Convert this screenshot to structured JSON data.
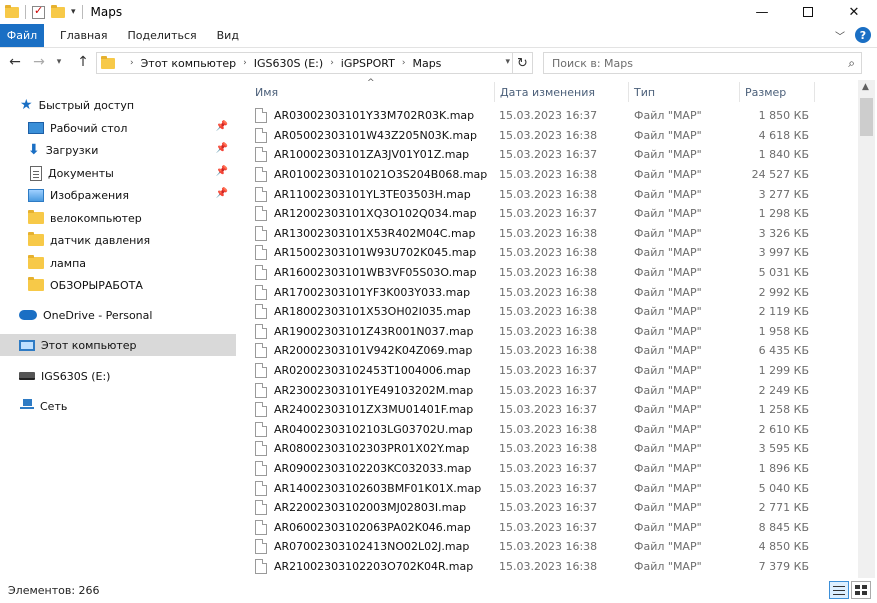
{
  "window": {
    "title": "Maps",
    "controls": {
      "minimize": "—",
      "close": "✕"
    }
  },
  "ribbon": {
    "tabs": [
      "Файл",
      "Главная",
      "Поделиться",
      "Вид"
    ],
    "accent": "#1a6fc4"
  },
  "address": {
    "crumbs": [
      "Этот компьютер",
      "IGS630S (E:)",
      "iGPSPORT",
      "Maps"
    ],
    "search_placeholder": "Поиск в: Maps"
  },
  "nav": {
    "items": [
      {
        "label": "Быстрый доступ",
        "icon": "star-icon"
      },
      {
        "label": "Рабочий стол",
        "icon": "desktop-icon",
        "pinned": true
      },
      {
        "label": "Загрузки",
        "icon": "download-icon",
        "pinned": true
      },
      {
        "label": "Документы",
        "icon": "documents-icon",
        "pinned": true
      },
      {
        "label": "Изображения",
        "icon": "pictures-icon",
        "pinned": true
      },
      {
        "label": "велокомпьютер",
        "icon": "folder-icon"
      },
      {
        "label": "датчик давления",
        "icon": "folder-icon"
      },
      {
        "label": "лампа",
        "icon": "folder-icon"
      },
      {
        "label": "ОБЗОРЫРАБОТА",
        "icon": "folder-icon"
      },
      {
        "label": "OneDrive - Personal",
        "icon": "onedrive-icon"
      },
      {
        "label": "Этот компьютер",
        "icon": "this-pc-icon",
        "selected": true
      },
      {
        "label": "IGS630S (E:)",
        "icon": "drive-icon"
      },
      {
        "label": "Сеть",
        "icon": "network-icon"
      }
    ]
  },
  "columns": [
    "Имя",
    "Дата изменения",
    "Тип",
    "Размер"
  ],
  "files": [
    {
      "name": "AR03002303101Y33M702R03K.map",
      "date": "15.03.2023 16:37",
      "type": "Файл \"MAP\"",
      "size": "1 850 КБ"
    },
    {
      "name": "AR05002303101W43Z205N03K.map",
      "date": "15.03.2023 16:38",
      "type": "Файл \"MAP\"",
      "size": "4 618 КБ"
    },
    {
      "name": "AR10002303101ZA3JV01Y01Z.map",
      "date": "15.03.2023 16:37",
      "type": "Файл \"MAP\"",
      "size": "1 840 КБ"
    },
    {
      "name": "AR01002303101021O3S204B068.map",
      "date": "15.03.2023 16:38",
      "type": "Файл \"MAP\"",
      "size": "24 527 КБ"
    },
    {
      "name": "AR11002303101YL3TE03503H.map",
      "date": "15.03.2023 16:38",
      "type": "Файл \"MAP\"",
      "size": "3 277 КБ"
    },
    {
      "name": "AR12002303101XQ3O102Q034.map",
      "date": "15.03.2023 16:37",
      "type": "Файл \"MAP\"",
      "size": "1 298 КБ"
    },
    {
      "name": "AR13002303101X53R402M04C.map",
      "date": "15.03.2023 16:38",
      "type": "Файл \"MAP\"",
      "size": "3 326 КБ"
    },
    {
      "name": "AR15002303101W93U702K045.map",
      "date": "15.03.2023 16:38",
      "type": "Файл \"MAP\"",
      "size": "3 997 КБ"
    },
    {
      "name": "AR16002303101WB3VF05S03O.map",
      "date": "15.03.2023 16:38",
      "type": "Файл \"MAP\"",
      "size": "5 031 КБ"
    },
    {
      "name": "AR17002303101YF3K003Y033.map",
      "date": "15.03.2023 16:38",
      "type": "Файл \"MAP\"",
      "size": "2 992 КБ"
    },
    {
      "name": "AR18002303101X53OH02I035.map",
      "date": "15.03.2023 16:38",
      "type": "Файл \"MAP\"",
      "size": "2 119 КБ"
    },
    {
      "name": "AR19002303101Z43R001N037.map",
      "date": "15.03.2023 16:38",
      "type": "Файл \"MAP\"",
      "size": "1 958 КБ"
    },
    {
      "name": "AR20002303101V942K04Z069.map",
      "date": "15.03.2023 16:38",
      "type": "Файл \"MAP\"",
      "size": "6 435 КБ"
    },
    {
      "name": "AR02002303102453T1004006.map",
      "date": "15.03.2023 16:37",
      "type": "Файл \"MAP\"",
      "size": "1 299 КБ"
    },
    {
      "name": "AR23002303101YE49103202M.map",
      "date": "15.03.2023 16:37",
      "type": "Файл \"MAP\"",
      "size": "2 249 КБ"
    },
    {
      "name": "AR24002303101ZX3MU01401F.map",
      "date": "15.03.2023 16:37",
      "type": "Файл \"MAP\"",
      "size": "1 258 КБ"
    },
    {
      "name": "AR04002303102103LG03702U.map",
      "date": "15.03.2023 16:38",
      "type": "Файл \"MAP\"",
      "size": "2 610 КБ"
    },
    {
      "name": "AR08002303102303PR01X02Y.map",
      "date": "15.03.2023 16:38",
      "type": "Файл \"MAP\"",
      "size": "3 595 КБ"
    },
    {
      "name": "AR09002303102203KC032033.map",
      "date": "15.03.2023 16:37",
      "type": "Файл \"MAP\"",
      "size": "1 896 КБ"
    },
    {
      "name": "AR14002303102603BMF01K01X.map",
      "date": "15.03.2023 16:37",
      "type": "Файл \"MAP\"",
      "size": "5 040 КБ"
    },
    {
      "name": "AR22002303102003MJ02803I.map",
      "date": "15.03.2023 16:37",
      "type": "Файл \"MAP\"",
      "size": "2 771 КБ"
    },
    {
      "name": "AR06002303102063PA02K046.map",
      "date": "15.03.2023 16:37",
      "type": "Файл \"MAP\"",
      "size": "8 845 КБ"
    },
    {
      "name": "AR07002303102413NO02L02J.map",
      "date": "15.03.2023 16:38",
      "type": "Файл \"MAP\"",
      "size": "4 850 КБ"
    },
    {
      "name": "AR21002303102203O702K04R.map",
      "date": "15.03.2023 16:38",
      "type": "Файл \"MAP\"",
      "size": "7 379 КБ"
    }
  ],
  "status": {
    "items_text": "Элементов: 266"
  }
}
